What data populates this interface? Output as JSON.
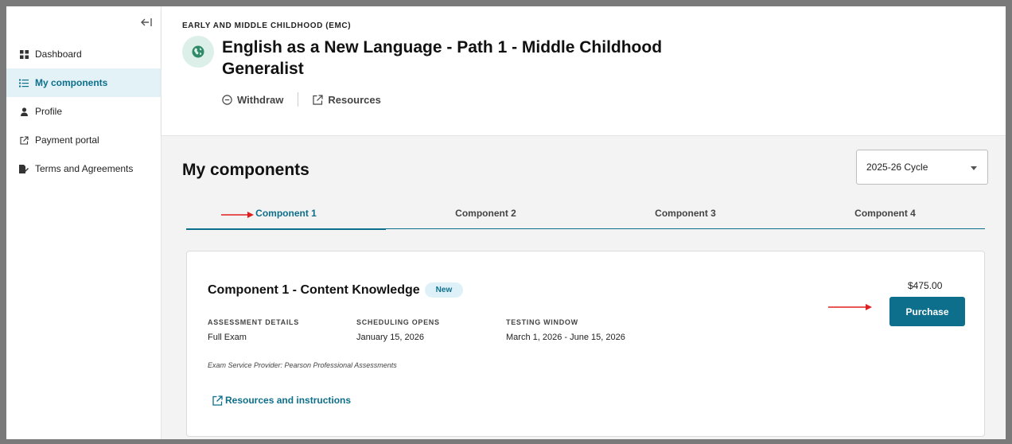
{
  "sidebar": {
    "items": [
      {
        "label": "Dashboard",
        "icon": "grid-icon",
        "active": false
      },
      {
        "label": "My components",
        "icon": "list-icon",
        "active": true
      },
      {
        "label": "Profile",
        "icon": "person-icon",
        "active": false
      },
      {
        "label": "Payment portal",
        "icon": "external-link-icon",
        "active": false
      },
      {
        "label": "Terms and Agreements",
        "icon": "document-sign-icon",
        "active": false
      }
    ]
  },
  "header": {
    "eyebrow": "EARLY AND MIDDLE CHILDHOOD (EMC)",
    "title": "English as a New Language - Path 1 - Middle Childhood Generalist",
    "withdraw_label": "Withdraw",
    "resources_label": "Resources"
  },
  "main": {
    "title": "My components",
    "cycle_select": "2025-26 Cycle",
    "tabs": [
      {
        "label": "Component 1",
        "active": true
      },
      {
        "label": "Component 2",
        "active": false
      },
      {
        "label": "Component 3",
        "active": false
      },
      {
        "label": "Component 4",
        "active": false
      }
    ],
    "card": {
      "title": "Component 1 - Content Knowledge",
      "badge": "New",
      "details": [
        {
          "label": "ASSESSMENT DETAILS",
          "value": "Full Exam"
        },
        {
          "label": "SCHEDULING OPENS",
          "value": "January 15, 2026"
        },
        {
          "label": "TESTING WINDOW",
          "value": "March 1, 2026 - June 15, 2026"
        }
      ],
      "provider": "Exam Service Provider: Pearson Professional Assessments",
      "resources_link": "Resources and instructions",
      "price": "$475.00",
      "purchase_label": "Purchase"
    }
  },
  "colors": {
    "accent": "#0d6f8c",
    "annotation_arrow": "#e02020",
    "active_nav_bg": "#e3f2f7"
  }
}
